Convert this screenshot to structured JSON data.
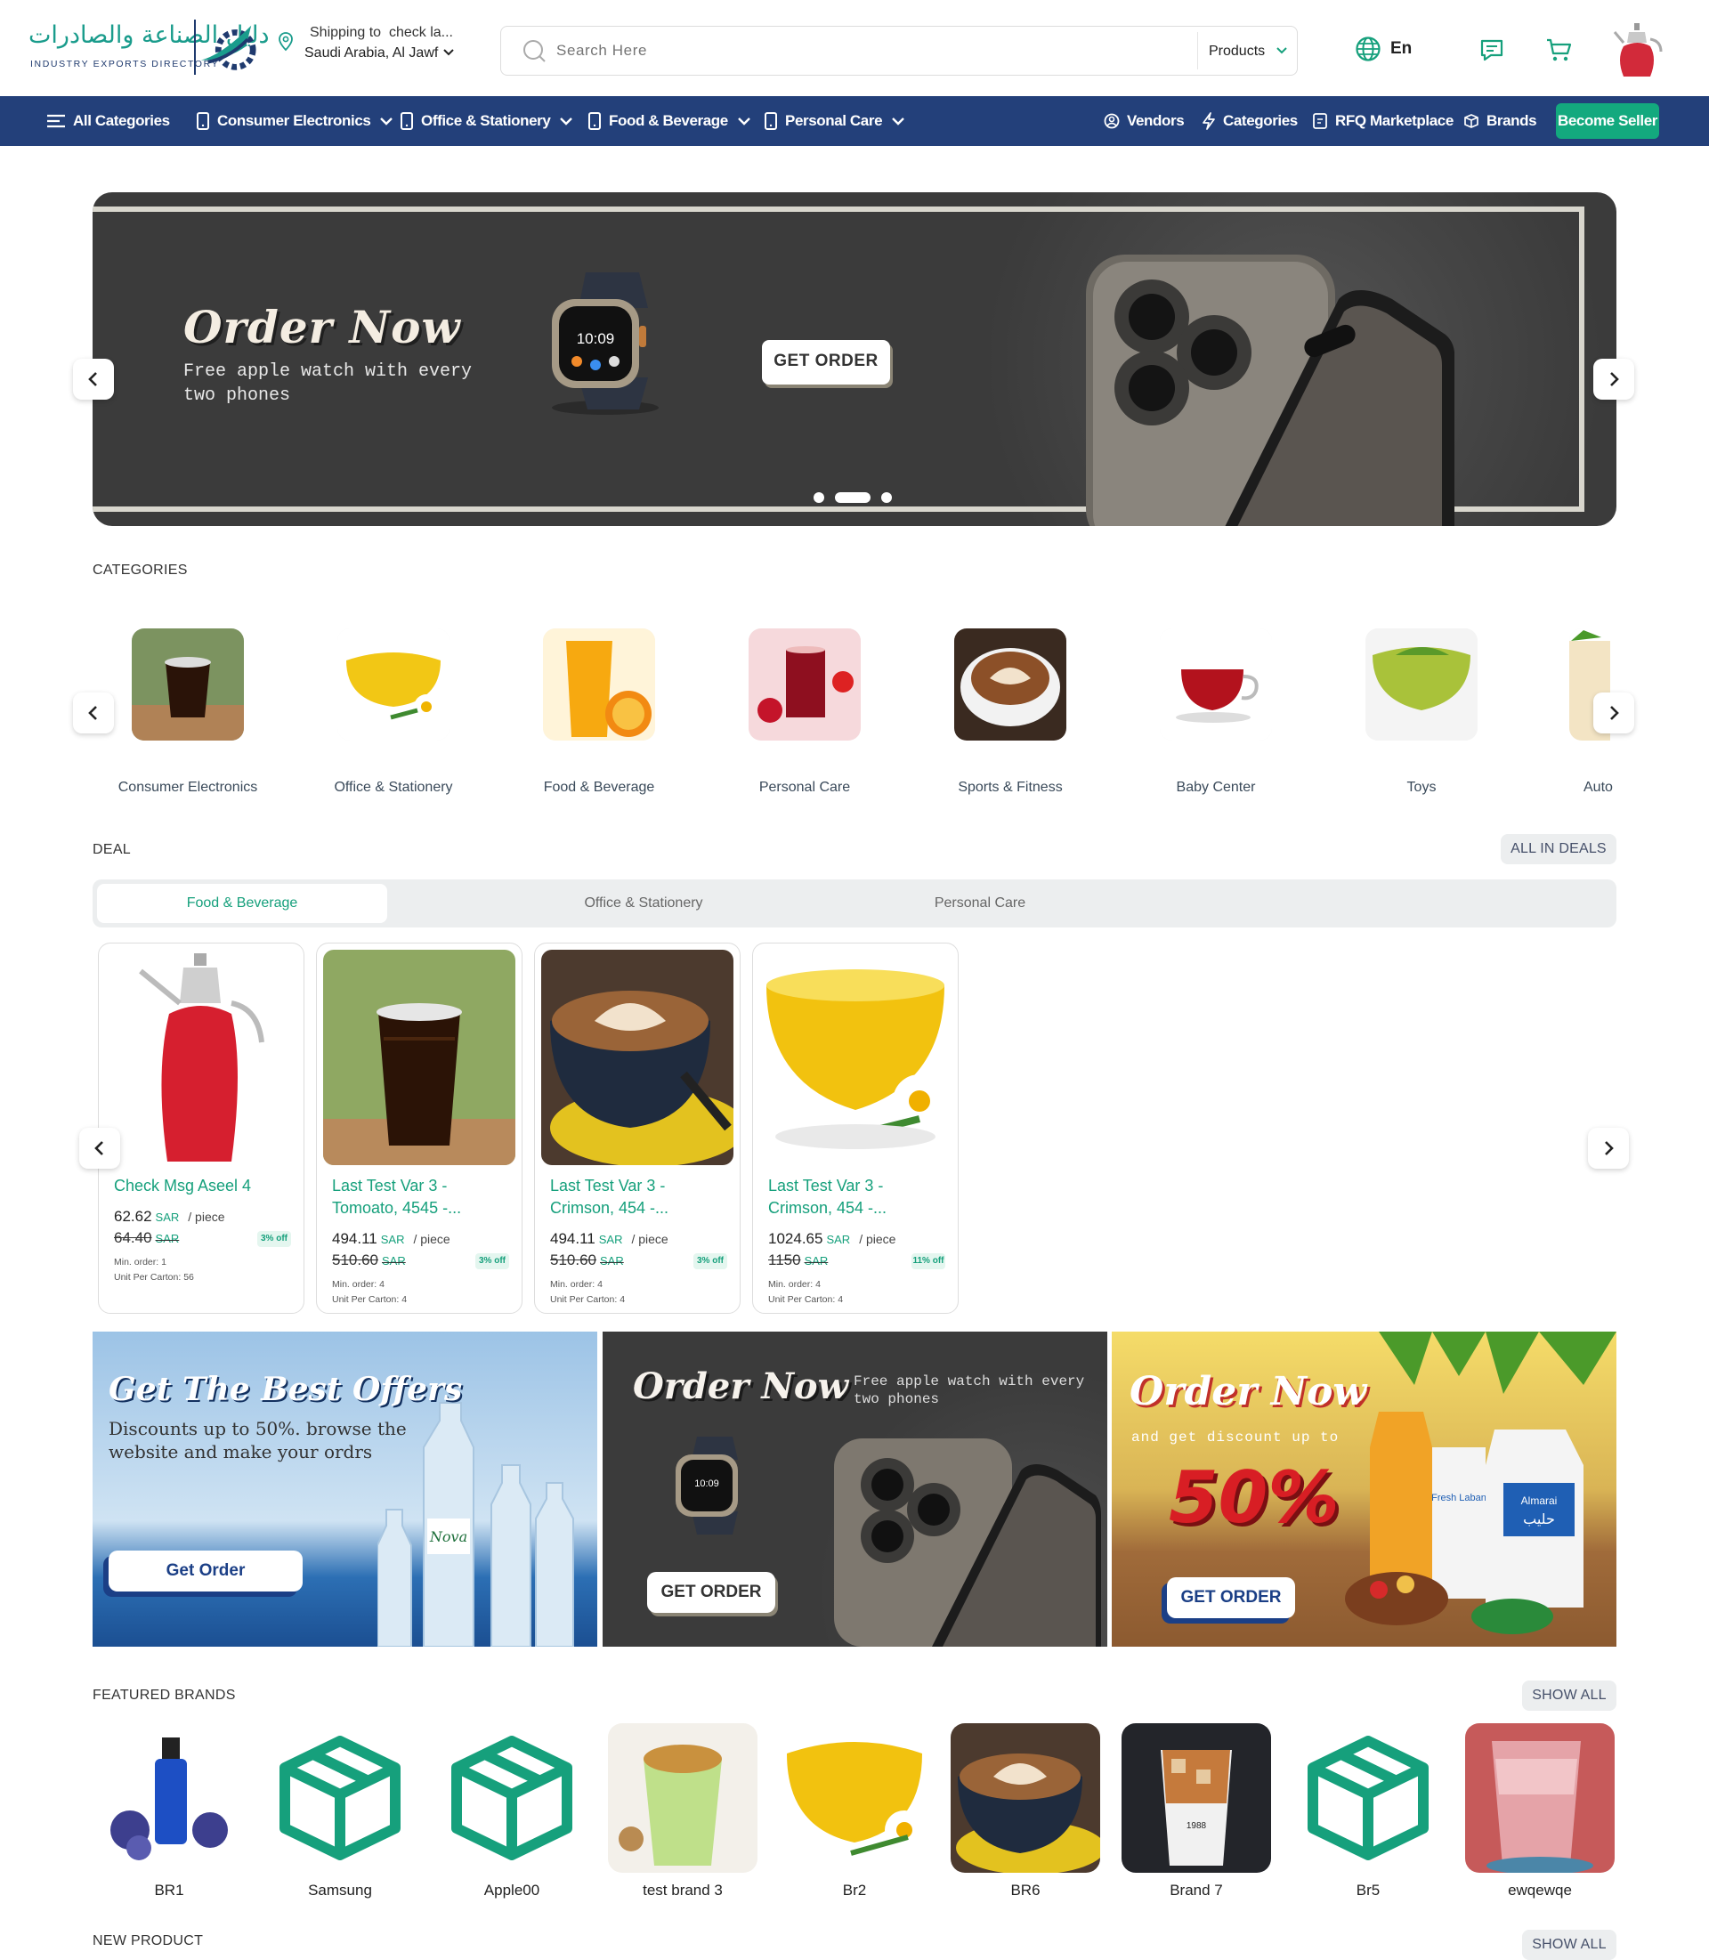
{
  "header": {
    "logo_ar": "دليل الصناعة والصادرات",
    "logo_en": "INDUSTRY EXPORTS DIRECTORY",
    "shipping_label": "Shipping to",
    "shipping_check": "check la...",
    "shipping_location": "Saudi Arabia, Al Jawf",
    "search_placeholder": "Search Here",
    "search_scope": "Products",
    "language": "En"
  },
  "nav": {
    "all_categories": "All Categories",
    "categories": [
      "Consumer Electronics",
      "Office & Stationery",
      "Food & Beverage",
      "Personal Care"
    ],
    "right_links": [
      "Vendors",
      "Categories",
      "RFQ Marketplace",
      "Brands"
    ],
    "become_seller": "Become Seller"
  },
  "hero": {
    "title": "Order Now",
    "subtitle": "Free apple watch with every two phones",
    "button": "GET ORDER",
    "watch_time": "10:09"
  },
  "categories": {
    "title": "CATEGORIES",
    "items": [
      "Consumer Electronics",
      "Office & Stationery",
      "Food & Beverage",
      "Personal Care",
      "Sports & Fitness",
      "Baby Center",
      "Toys",
      "Auto"
    ]
  },
  "deals": {
    "title": "DEAL",
    "all_button": "ALL IN DEALS",
    "tabs": [
      "Food & Beverage",
      "Office & Stationery",
      "Personal Care"
    ],
    "products": [
      {
        "name": "Check Msg Aseel 4",
        "price": "62.62",
        "currency": "SAR",
        "unit": "/ piece",
        "old_price": "64.40",
        "off": "3% off",
        "min_order": "Min. order: 1",
        "unit_carton": "Unit Per Carton: 56"
      },
      {
        "name": "Last Test Var 3 - Tomoato, 4545 -...",
        "price": "494.11",
        "currency": "SAR",
        "unit": "/ piece",
        "old_price": "510.60",
        "off": "3% off",
        "min_order": "Min. order: 4",
        "unit_carton": "Unit Per Carton: 4"
      },
      {
        "name": "Last Test Var 3 - Crimson, 454 -...",
        "price": "494.11",
        "currency": "SAR",
        "unit": "/ piece",
        "old_price": "510.60",
        "off": "3% off",
        "min_order": "Min. order: 4",
        "unit_carton": "Unit Per Carton: 4"
      },
      {
        "name": "Last Test Var 3 - Crimson, 454 -...",
        "price": "1024.65",
        "currency": "SAR",
        "unit": "/ piece",
        "old_price": "1150",
        "off": "11% off",
        "min_order": "Min. order: 4",
        "unit_carton": "Unit Per Carton: 4"
      }
    ]
  },
  "banners": [
    {
      "title": "Get The Best Offers",
      "text": "Discounts up to 50%. browse the website and make your ordrs",
      "button": "Get Order",
      "label": "Nova"
    },
    {
      "title": "Order Now",
      "text": "Free apple watch with every two phones",
      "button": "GET ORDER",
      "watch_time": "10:09"
    },
    {
      "title": "Order Now",
      "text": "and get discount up to",
      "discount": "50%",
      "button": "GET ORDER",
      "label": "Almarai",
      "label2": "Fresh Laban",
      "label3": "حليب"
    }
  ],
  "brands": {
    "title": "FEATURED BRANDS",
    "show_all": "SHOW ALL",
    "items": [
      "BR1",
      "Samsung",
      "Apple00",
      "test brand 3",
      "Br2",
      "BR6",
      "Brand 7",
      "Br5",
      "ewqewqe"
    ],
    "cup_print": "1988"
  },
  "new_product": {
    "title": "NEW PRODUCT",
    "show_all": "SHOW ALL"
  },
  "colors": {
    "nav_bg": "#23407a",
    "accent": "#16a07c",
    "seller_bg": "#13a97e",
    "hero_bg": "#3b3b3b"
  }
}
